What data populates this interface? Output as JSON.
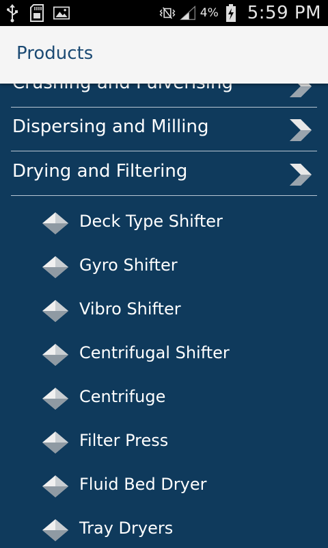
{
  "status_bar": {
    "battery_percent": "4%",
    "time": "5:59 PM",
    "icons": [
      "usb-icon",
      "sd-card-icon",
      "image-icon",
      "vibrate-icon",
      "signal-icon",
      "battery-charging-icon"
    ]
  },
  "header": {
    "title": "Products"
  },
  "categories": [
    {
      "label": "Crushing and Pulverising"
    },
    {
      "label": "Dispersing and Milling"
    },
    {
      "label": "Drying and Filtering"
    }
  ],
  "sub_items": [
    {
      "label": "Deck Type Shifter"
    },
    {
      "label": "Gyro Shifter"
    },
    {
      "label": "Vibro Shifter"
    },
    {
      "label": "Centrifugal Shifter"
    },
    {
      "label": "Centrifuge"
    },
    {
      "label": "Filter Press"
    },
    {
      "label": "Fluid Bed Dryer"
    },
    {
      "label": "Tray Dryers"
    }
  ],
  "colors": {
    "background": "#0f3a5c",
    "header_bg": "#f5f5f5",
    "header_text": "#1b4a73",
    "divider": "#b9c7d4"
  }
}
